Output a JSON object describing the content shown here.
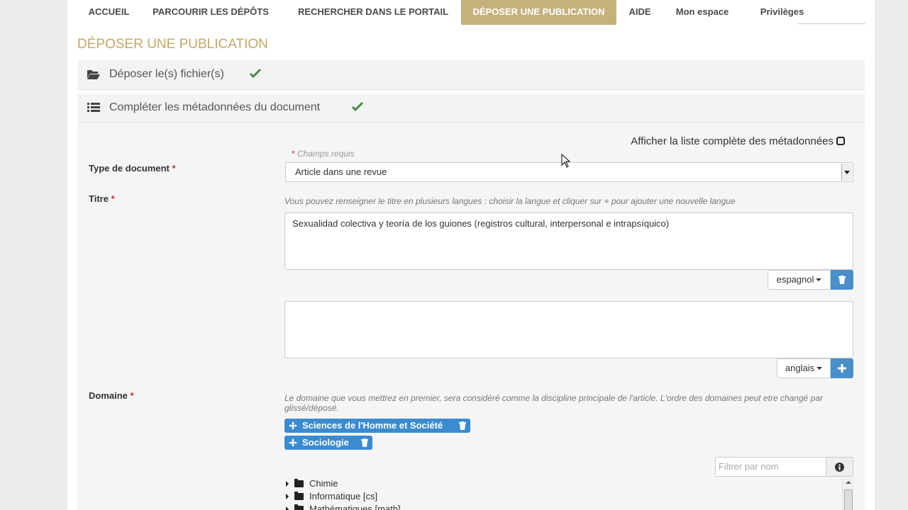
{
  "nav": {
    "items": [
      {
        "label": "ACCUEIL"
      },
      {
        "label": "PARCOURIR LES DÉPÔTS"
      },
      {
        "label": "RECHERCHER DANS LE PORTAIL"
      },
      {
        "label": "DÉPOSER UNE PUBLICATION"
      },
      {
        "label": "AIDE"
      },
      {
        "label": "Mon espace"
      },
      {
        "label": "Privilèges"
      }
    ]
  },
  "page_title": "DÉPOSER UNE PUBLICATION",
  "steps": {
    "upload": {
      "label": "Déposer le(s) fichier(s)",
      "icon": "folder-open-icon",
      "status": "check-icon"
    },
    "metadata": {
      "label": "Compléter les métadonnées du document",
      "icon": "list-icon",
      "status": "check-icon"
    }
  },
  "form": {
    "full_list_label": "Afficher la liste complète des métadonnées",
    "required_mark": "*",
    "required_note": "Champs requis",
    "doc_type": {
      "label": "Type de document",
      "value": "Article dans une revue"
    },
    "title": {
      "label": "Titre",
      "help": "Vous pouvez renseigner le titre en plusieurs langues : choisir la langue et cliquer sur + pour ajouter une nouvelle langue",
      "entries": [
        {
          "value": "Sexualidad colectiva y teoría de los guiones (registros cultural, interpersonal e intrapsíquico)",
          "language": "espagnol",
          "action_icon": "trash-icon"
        },
        {
          "value": "",
          "language": "anglais",
          "action_icon": "plus-icon"
        }
      ]
    },
    "domain": {
      "label": "Domaine",
      "help": "Le domaine que vous mettrez en premier, sera considéré comme la discipline principale de l'article. L'ordre des domaines peut etre changé par glissé/déposé.",
      "tags": [
        "Sciences de l'Homme et Société",
        "Sociologie"
      ],
      "filter_placeholder": "Filtrer par nom",
      "tree": [
        "Chimie",
        "Informatique [cs]",
        "Mathématiques [math]"
      ]
    }
  },
  "colors": {
    "accent": "#c5b17c",
    "title": "#c2a866",
    "button_blue": "#4a8fca",
    "check": "#4a8a4a",
    "required": "#c9302c"
  }
}
